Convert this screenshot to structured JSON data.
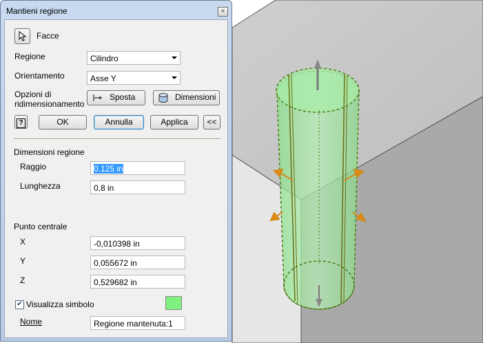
{
  "dialog": {
    "title": "Mantieni regione",
    "close_glyph": "×",
    "faces_label": "Facce",
    "region_label": "Regione",
    "region_value": "Cilindro",
    "orientation_label": "Orientamento",
    "orientation_value": "Asse Y",
    "resize_label_line1": "Opzioni di",
    "resize_label_line2": "ridimensionamento",
    "move_button": "Sposta",
    "dimensions_button": "Dimensioni",
    "help_glyph": "?",
    "ok_button": "OK",
    "cancel_button": "Annulla",
    "apply_button": "Applica",
    "collapse_button": "<<",
    "dimensions_section": "Dimensioni regione",
    "radius_label": "Raggio",
    "radius_value": "0.125 in",
    "length_label": "Lunghezza",
    "length_value": "0,8 in",
    "center_section": "Punto centrale",
    "x_label": "X",
    "x_value": "-0,010398 in",
    "y_label": "Y",
    "y_value": "0,055672 in",
    "z_label": "Z",
    "z_value": "0,529682 in",
    "show_symbol_label": "Visualizza simbolo",
    "show_symbol_checked": true,
    "symbol_color": "#80f080",
    "name_label": "Nome",
    "name_value": "Regione mantenuta:1"
  },
  "icons": {
    "pointer": "cursor-arrow-icon",
    "move": "move-icon",
    "dimensions": "cylinder-icon"
  }
}
